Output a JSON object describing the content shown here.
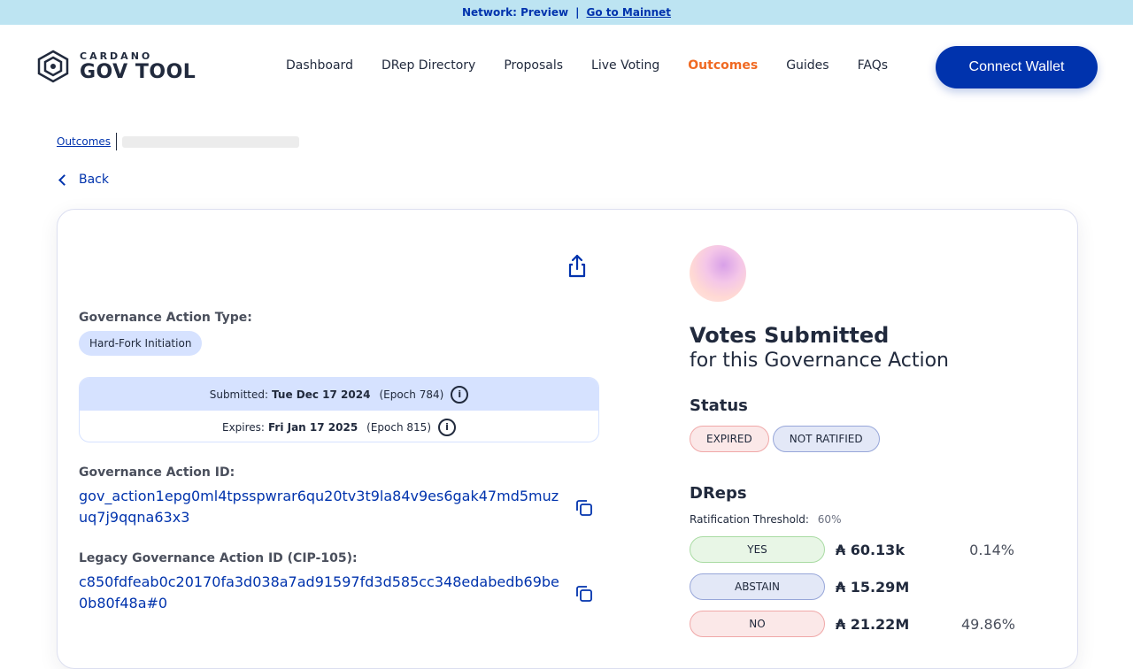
{
  "topbar": {
    "network": "Network: Preview",
    "separator": "|",
    "mainnet_link": "Go to Mainnet"
  },
  "logo": {
    "small": "CARDANO",
    "big": "GOV TOOL"
  },
  "nav": {
    "items": [
      {
        "label": "Dashboard",
        "active": false
      },
      {
        "label": "DRep Directory",
        "active": false
      },
      {
        "label": "Proposals",
        "active": false
      },
      {
        "label": "Live Voting",
        "active": false
      },
      {
        "label": "Outcomes",
        "active": true
      },
      {
        "label": "Guides",
        "active": false
      },
      {
        "label": "FAQs",
        "active": false
      }
    ],
    "connect_label": "Connect Wallet"
  },
  "breadcrumb": {
    "root": "Outcomes"
  },
  "back_label": "Back",
  "action": {
    "type_label": "Governance Action Type:",
    "type_value": "Hard-Fork Initiation",
    "submitted_prefix": "Submitted:",
    "submitted_date": "Tue Dec 17 2024",
    "submitted_epoch": "(Epoch 784)",
    "expires_prefix": "Expires:",
    "expires_date": "Fri Jan 17 2025",
    "expires_epoch": "(Epoch 815)",
    "id_label": "Governance Action ID:",
    "id_value": "gov_action1epg0ml4tpsspwrar6qu20tv3t9la84v9es6gak47md5muzuq7j9qqna63x3",
    "legacy_label": "Legacy Governance Action ID (CIP-105):",
    "legacy_value": "c850fdfeab0c20170fa3d038a7ad91597fd3d585cc348edabedb69be0b80f48a#0"
  },
  "votes": {
    "title": "Votes Submitted",
    "subtitle": "for this Governance Action",
    "status_title": "Status",
    "status_badges": [
      "EXPIRED",
      "NOT RATIFIED"
    ],
    "dreps_title": "DReps",
    "threshold_label": "Ratification Threshold:",
    "threshold_value": "60%",
    "rows": [
      {
        "label": "YES",
        "amount": "₳ 60.13k",
        "pct": "0.14%"
      },
      {
        "label": "ABSTAIN",
        "amount": "₳ 15.29M",
        "pct": ""
      },
      {
        "label": "NO",
        "amount": "₳ 21.22M",
        "pct": "49.86%"
      }
    ]
  },
  "colors": {
    "primary": "#0033ad",
    "active_nav": "#f06a23",
    "topbar_bg": "#bde4f2"
  }
}
